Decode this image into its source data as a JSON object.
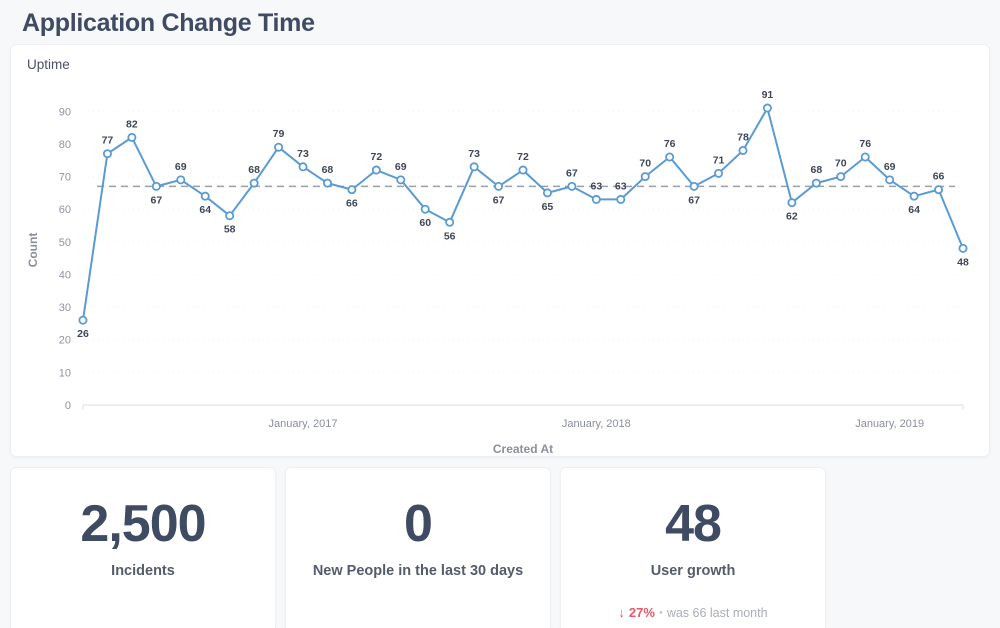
{
  "header": {
    "title": "Application Change Time"
  },
  "chart_card": {
    "legend_title": "Uptime"
  },
  "chart_data": {
    "type": "line",
    "title": "Uptime",
    "xlabel": "Created At",
    "ylabel": "Count",
    "ylim": [
      0,
      95
    ],
    "y_ticks": [
      0,
      10,
      20,
      30,
      40,
      50,
      60,
      70,
      80,
      90
    ],
    "x_tick_labels": [
      "January, 2017",
      "January, 2018",
      "January, 2019"
    ],
    "x_tick_indices": [
      9,
      21,
      33
    ],
    "grid": true,
    "legend_position": "top-left",
    "series": [
      {
        "name": "Uptime",
        "color": "#5a9bd4",
        "marker": "open-circle",
        "values": [
          26,
          77,
          82,
          67,
          69,
          64,
          58,
          68,
          79,
          73,
          68,
          66,
          72,
          69,
          60,
          56,
          73,
          67,
          72,
          65,
          67,
          63,
          63,
          70,
          76,
          67,
          71,
          78,
          91,
          62,
          68,
          70,
          76,
          69,
          64,
          66,
          48
        ]
      }
    ],
    "reference_line": {
      "value": 67,
      "style": "dashed",
      "color": "#9aa0a8"
    },
    "point_label_offsets": [
      "below",
      "above",
      "above",
      "below",
      "above",
      "below",
      "below",
      "above",
      "above",
      "above",
      "above",
      "below",
      "above",
      "above",
      "below",
      "below",
      "above",
      "below",
      "above",
      "below",
      "above",
      "above",
      "above",
      "above",
      "above",
      "below",
      "above",
      "above",
      "above",
      "below",
      "above",
      "above",
      "above",
      "above",
      "below",
      "above",
      "below"
    ]
  },
  "stats": [
    {
      "value": "2,500",
      "label": "Incidents"
    },
    {
      "value": "0",
      "label": "New People in the last 30 days"
    },
    {
      "value": "48",
      "label": "User growth",
      "delta": {
        "arrow": "down-arrow-icon",
        "arrow_glyph": "↓",
        "percent": "27%",
        "separator": "•",
        "comparison": "was 66  last month"
      }
    }
  ],
  "colors": {
    "line": "#5a9bd4",
    "reference": "#9aa0a8",
    "negative": "#e4586b",
    "text_dark": "#3f4a63",
    "background": "#f7f8fa"
  }
}
